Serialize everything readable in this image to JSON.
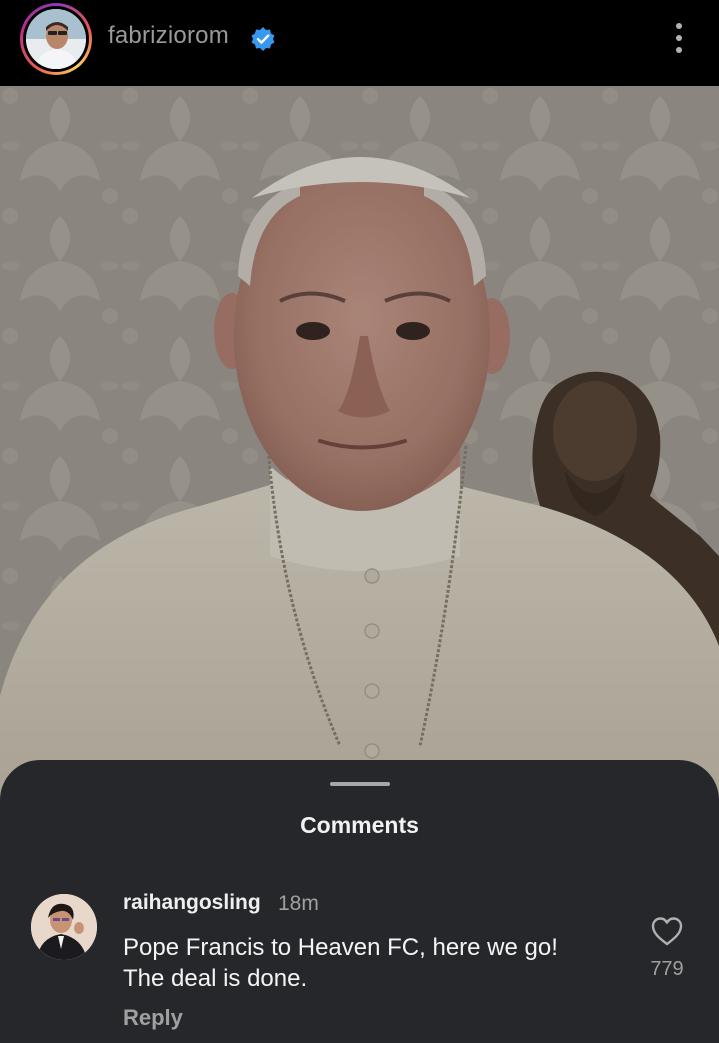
{
  "post": {
    "username": "fabriziorom",
    "verified": true,
    "avatar_icon": "profile-avatar",
    "menu_icon": "more-vertical-icon"
  },
  "comments_sheet": {
    "title": "Comments",
    "comments": [
      {
        "username": "raihangosling",
        "time": "18m",
        "text_line1": "Pope Francis to Heaven FC, here we go!",
        "text_line2": "The deal is done.",
        "reply_label": "Reply",
        "like_count": "779",
        "like_icon": "heart-outline-icon"
      }
    ]
  },
  "colors": {
    "verified_badge": "#3897f0",
    "sheet_background": "#25272b",
    "muted_text": "#a0a0a0"
  }
}
